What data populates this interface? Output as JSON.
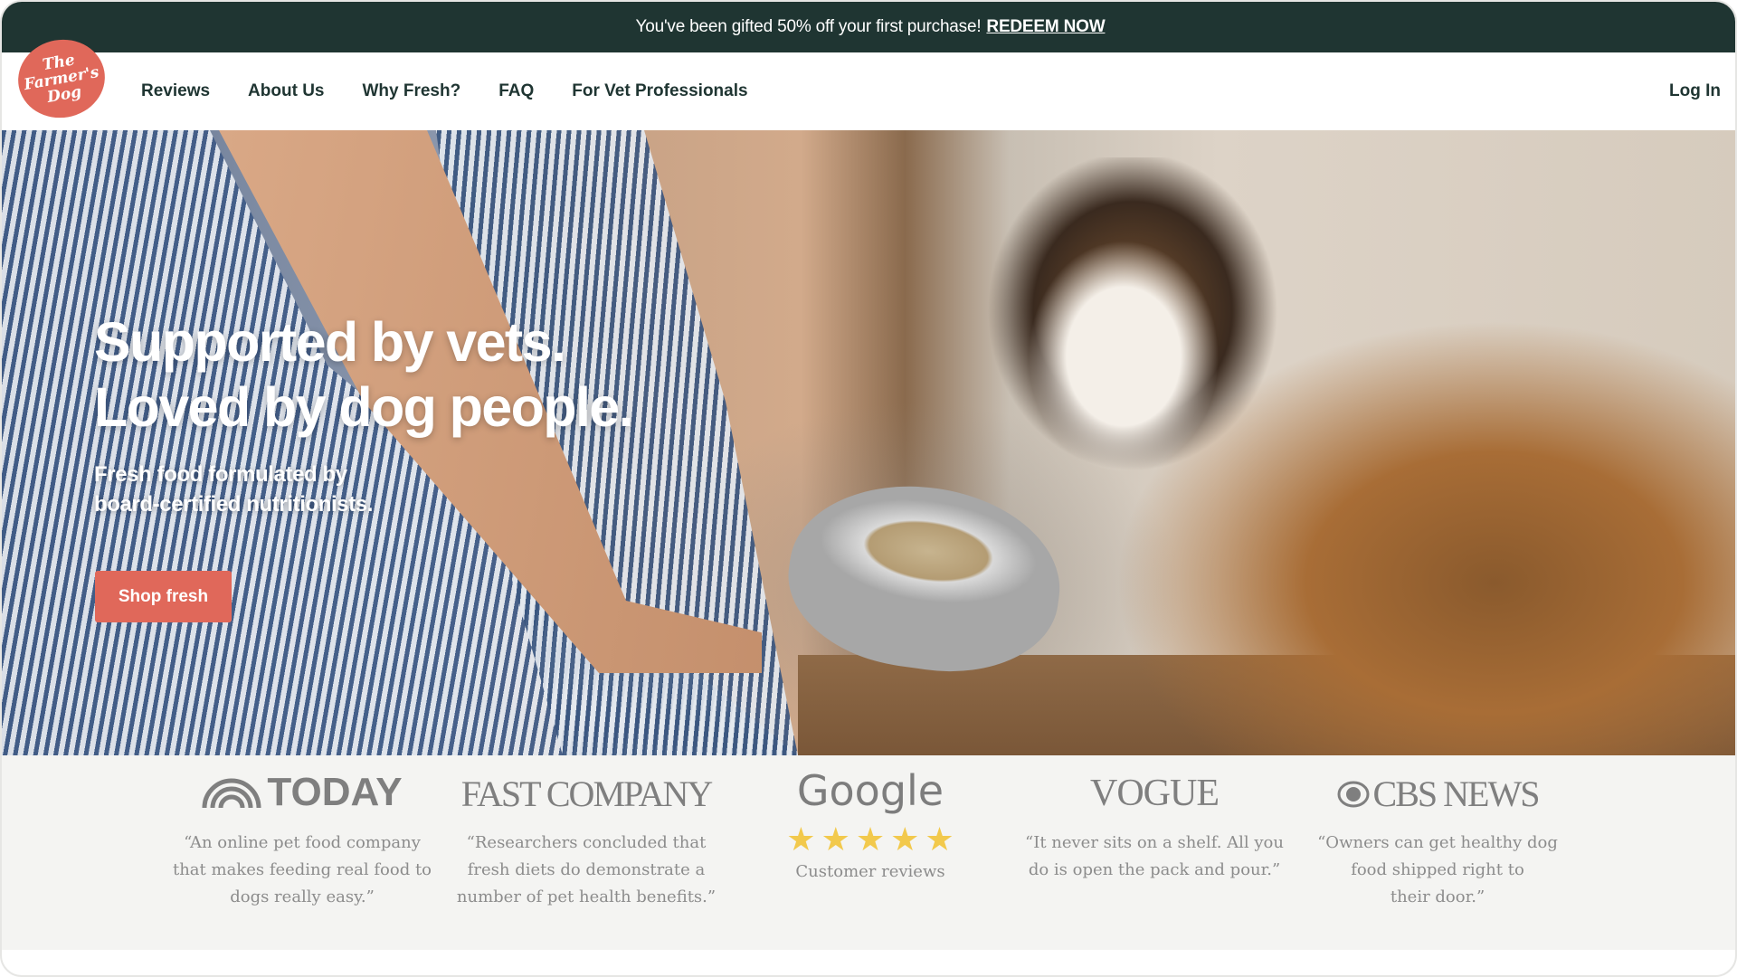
{
  "promo": {
    "text": "You've been gifted 50% off your first purchase!",
    "cta": "REDEEM NOW"
  },
  "nav": {
    "logo_lines": [
      "The",
      "Farmer's",
      "Dog"
    ],
    "links": [
      "Reviews",
      "About Us",
      "Why Fresh?",
      "FAQ",
      "For Vet Professionals"
    ],
    "login": "Log In"
  },
  "hero": {
    "title_line1": "Supported by vets.",
    "title_line2": "Loved by dog people.",
    "sub_line1": "Fresh food formulated by",
    "sub_line2": "board-certified nutritionists.",
    "button": "Shop fresh"
  },
  "press": [
    {
      "logo": "TODAY",
      "quote": [
        "“An online pet food company",
        "that makes feeding real food to",
        "dogs really easy.”"
      ]
    },
    {
      "logo": "FAST COMPANY",
      "quote": [
        "“Researchers concluded that",
        "fresh diets do demonstrate a",
        "number of pet health benefits.”"
      ]
    },
    {
      "logo": "Google",
      "rating_stars": 5,
      "label": "Customer reviews"
    },
    {
      "logo": "VOGUE",
      "quote": [
        "“It never sits on a shelf. All you",
        "do is open the pack and pour.”"
      ]
    },
    {
      "logo": "CBS NEWS",
      "quote": [
        "“Owners can get healthy dog",
        "food shipped right to",
        "their door.”"
      ]
    }
  ],
  "colors": {
    "banner": "#1f3532",
    "brand": "#e0685a",
    "press_bg": "#f4f4f2",
    "star": "#f2c94c"
  }
}
